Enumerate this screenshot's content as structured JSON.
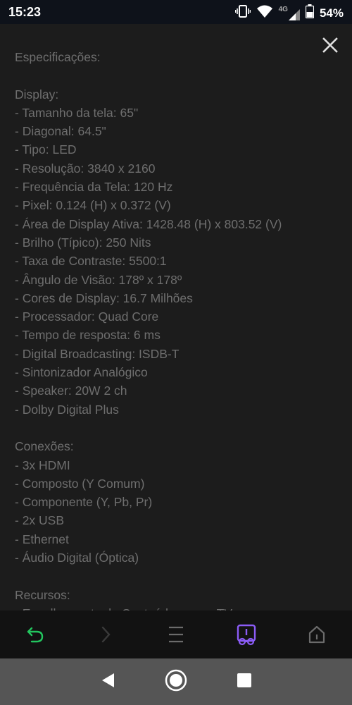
{
  "status_bar": {
    "time": "15:23",
    "network": "4G",
    "battery": "54%"
  },
  "content": {
    "lines": [
      "Especificações:",
      "",
      "Display:",
      "- Tamanho da tela: 65\"",
      "- Diagonal: 64.5\"",
      "- Tipo: LED",
      "- Resolução: 3840 x 2160",
      "- Frequência da Tela: 120 Hz",
      "- Pixel: 0.124 (H) x 0.372 (V)",
      "- Área de Display Ativa: 1428.48 (H) x 803.52 (V)",
      "- Brilho (Típico): 250 Nits",
      "- Taxa de Contraste: 5500:1",
      "- Ângulo de Visão: 178º x 178º",
      "- Cores de Display: 16.7 Milhões",
      "- Processador: Quad Core",
      "- Tempo de resposta: 6 ms",
      "- Digital Broadcasting: ISDB-T",
      "- Sintonizador Analógico",
      "- Speaker: 20W 2 ch",
      "- Dolby Digital Plus",
      "",
      "Conexões:",
      "- 3x HDMI",
      "- Composto (Y Comum)",
      "- Componente (Y, Pb, Pr)",
      "- 2x USB",
      "- Ethernet",
      "- Áudio Digital (Óptica)",
      "",
      "Recursos:",
      "- Espelhamento de Conteúdo para a TV"
    ]
  },
  "colors": {
    "back_icon": "#22c55e",
    "active_tab": "#8b5cf6",
    "inactive_icon": "#6b6b6b",
    "text": "#6e6e6e"
  },
  "icons": {
    "close": "close-icon",
    "back": "undo-arrow-icon",
    "forward": "chevron-right-icon",
    "menu": "menu-icon",
    "reader": "reader-mode-icon",
    "home": "home-icon"
  }
}
